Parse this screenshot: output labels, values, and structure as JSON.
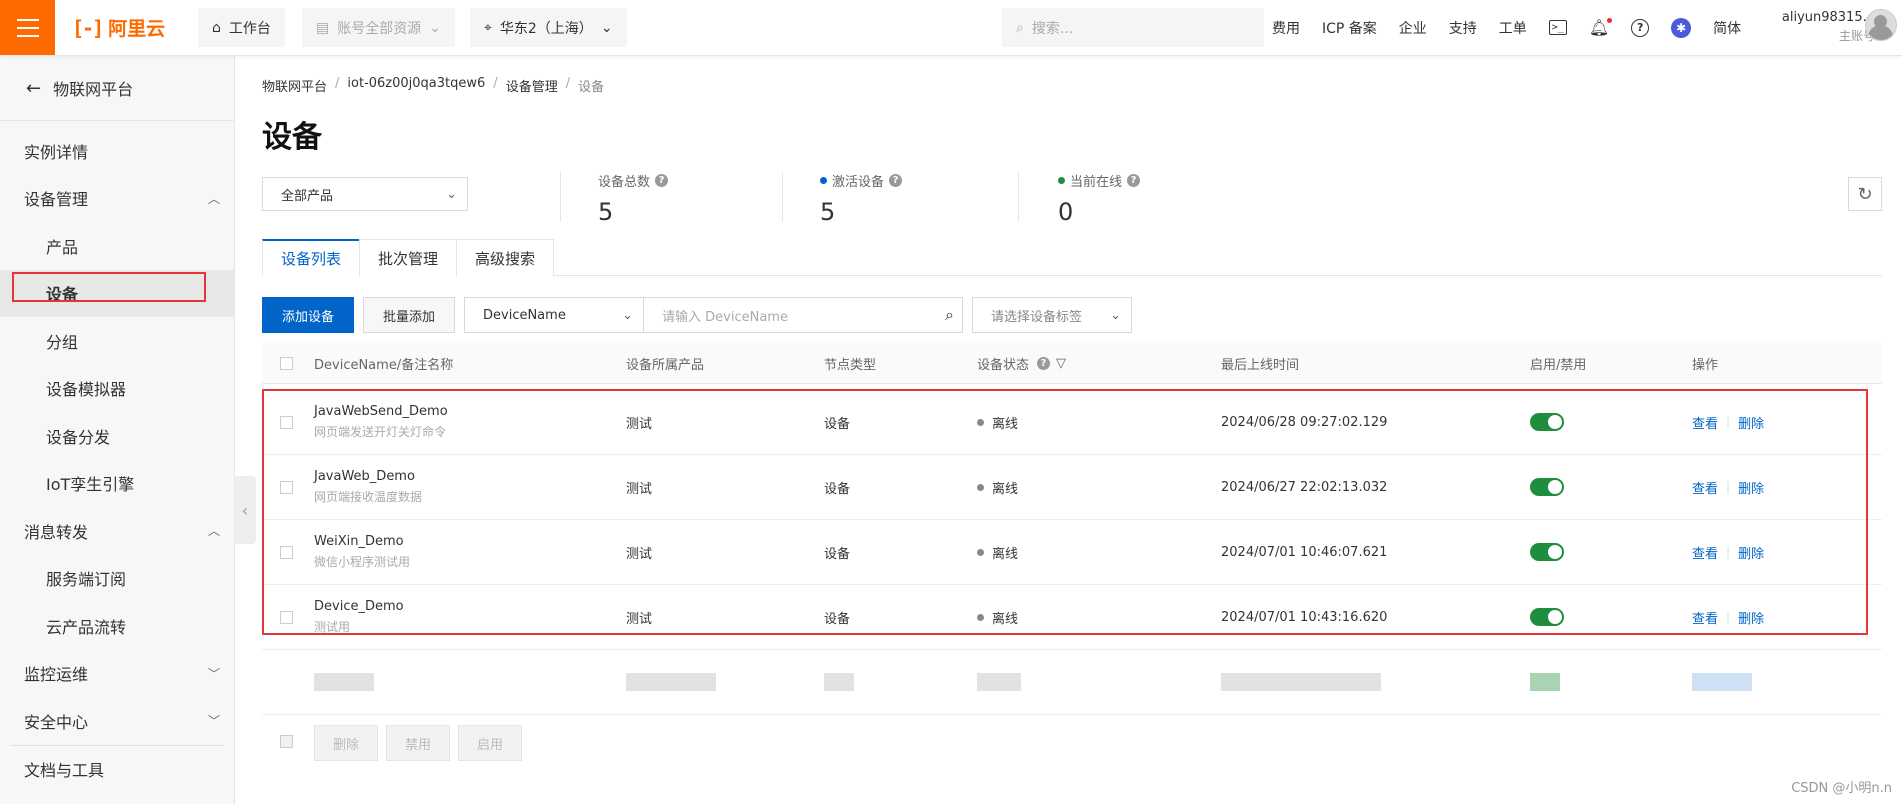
{
  "topbar": {
    "logo": "阿里云",
    "logo_mark": "[-]",
    "workbench": "工作台",
    "account_resources": "账号全部资源",
    "region": "华东2（上海）",
    "search_placeholder": "搜索...",
    "links": [
      "费用",
      "ICP 备案",
      "企业",
      "支持",
      "工单"
    ],
    "lang": "简体",
    "username": "aliyun98315...",
    "account_type": "主账号"
  },
  "sidebar": {
    "back_label": "物联网平台",
    "items": [
      {
        "label": "实例详情",
        "level": 1
      },
      {
        "label": "设备管理",
        "level": 1,
        "expanded": true
      },
      {
        "label": "产品",
        "level": 2
      },
      {
        "label": "设备",
        "level": 2,
        "active": true
      },
      {
        "label": "分组",
        "level": 2
      },
      {
        "label": "设备模拟器",
        "level": 2
      },
      {
        "label": "设备分发",
        "level": 2
      },
      {
        "label": "IoT孪生引擎",
        "level": 2
      },
      {
        "label": "消息转发",
        "level": 1,
        "expanded": true
      },
      {
        "label": "服务端订阅",
        "level": 2
      },
      {
        "label": "云产品流转",
        "level": 2
      },
      {
        "label": "监控运维",
        "level": 1,
        "expanded": false
      },
      {
        "label": "安全中心",
        "level": 1,
        "expanded": false
      }
    ],
    "docs_label": "文档与工具"
  },
  "breadcrumb": [
    "物联网平台",
    "iot-06z00j0qa3tqew6",
    "设备管理",
    "设备"
  ],
  "page_title": "设备",
  "product_filter": "全部产品",
  "stats": {
    "total_label": "设备总数",
    "total_value": "5",
    "active_label": "激活设备",
    "active_value": "5",
    "online_label": "当前在线",
    "online_value": "0"
  },
  "tabs": [
    "设备列表",
    "批次管理",
    "高级搜索"
  ],
  "toolbar": {
    "add_device": "添加设备",
    "batch_add": "批量添加",
    "search_type": "DeviceName",
    "search_placeholder": "请输入 DeviceName",
    "tag_placeholder": "请选择设备标签"
  },
  "table": {
    "headers": [
      "DeviceName/备注名称",
      "设备所属产品",
      "节点类型",
      "设备状态",
      "最后上线时间",
      "启用/禁用",
      "操作"
    ],
    "rows": [
      {
        "name": "JavaWebSend_Demo",
        "note": "网页端发送开灯关灯命令",
        "product": "测试",
        "node": "设备",
        "status": "离线",
        "last_online": "2024/06/28 09:27:02.129",
        "enabled": true,
        "view": "查看",
        "delete": "删除"
      },
      {
        "name": "JavaWeb_Demo",
        "note": "网页端接收温度数据",
        "product": "测试",
        "node": "设备",
        "status": "离线",
        "last_online": "2024/06/27 22:02:13.032",
        "enabled": true,
        "view": "查看",
        "delete": "删除"
      },
      {
        "name": "WeiXin_Demo",
        "note": "微信小程序测试用",
        "product": "测试",
        "node": "设备",
        "status": "离线",
        "last_online": "2024/07/01 10:46:07.621",
        "enabled": true,
        "view": "查看",
        "delete": "删除"
      },
      {
        "name": "Device_Demo",
        "note": "测试用",
        "product": "测试",
        "node": "设备",
        "status": "离线",
        "last_online": "2024/07/01 10:43:16.620",
        "enabled": true,
        "view": "查看",
        "delete": "删除"
      }
    ]
  },
  "bulk_actions": {
    "delete": "删除",
    "disable": "禁用",
    "enable": "启用"
  },
  "watermark": "CSDN @小明n.n",
  "colors": {
    "accent": "#0064c8",
    "brand": "#ff6a00",
    "highlight": "#e5353b",
    "toggle_on": "#1e8e3e"
  }
}
